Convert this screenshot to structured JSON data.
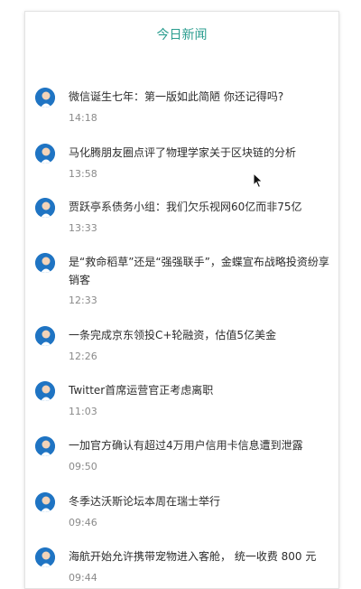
{
  "header": {
    "title": "今日新闻"
  },
  "news": [
    {
      "headline": "微信诞生七年：第一版如此简陋 你还记得吗?",
      "time": "14:18",
      "avatar_icon": "person-avatar-icon"
    },
    {
      "headline": "马化腾朋友圈点评了物理学家关于区块链的分析",
      "time": "13:58",
      "avatar_icon": "person-avatar-icon"
    },
    {
      "headline": "贾跃亭系债务小组：我们欠乐视网60亿而非75亿",
      "time": "13:33",
      "avatar_icon": "person-avatar-icon"
    },
    {
      "headline": "是“救命稻草”还是“强强联手”，金蝶宣布战略投资纷享销客",
      "time": "12:33",
      "avatar_icon": "person-avatar-icon"
    },
    {
      "headline": "一条完成京东领投C+轮融资，估值5亿美金",
      "time": "12:26",
      "avatar_icon": "person-avatar-icon"
    },
    {
      "headline": "Twitter首席运营官正考虑离职",
      "time": "11:03",
      "avatar_icon": "person-avatar-icon"
    },
    {
      "headline": "一加官方确认有超过4万用户信用卡信息遭到泄露",
      "time": "09:50",
      "avatar_icon": "person-avatar-icon"
    },
    {
      "headline": "冬季达沃斯论坛本周在瑞士举行",
      "time": "09:46",
      "avatar_icon": "person-avatar-icon"
    },
    {
      "headline": "海航开始允许携带宠物进入客舱， 统一收费 800 元",
      "time": "09:44",
      "avatar_icon": "person-avatar-icon"
    }
  ],
  "colors": {
    "accent": "#2a9d8f",
    "avatar_bg": "#1f74c3"
  }
}
